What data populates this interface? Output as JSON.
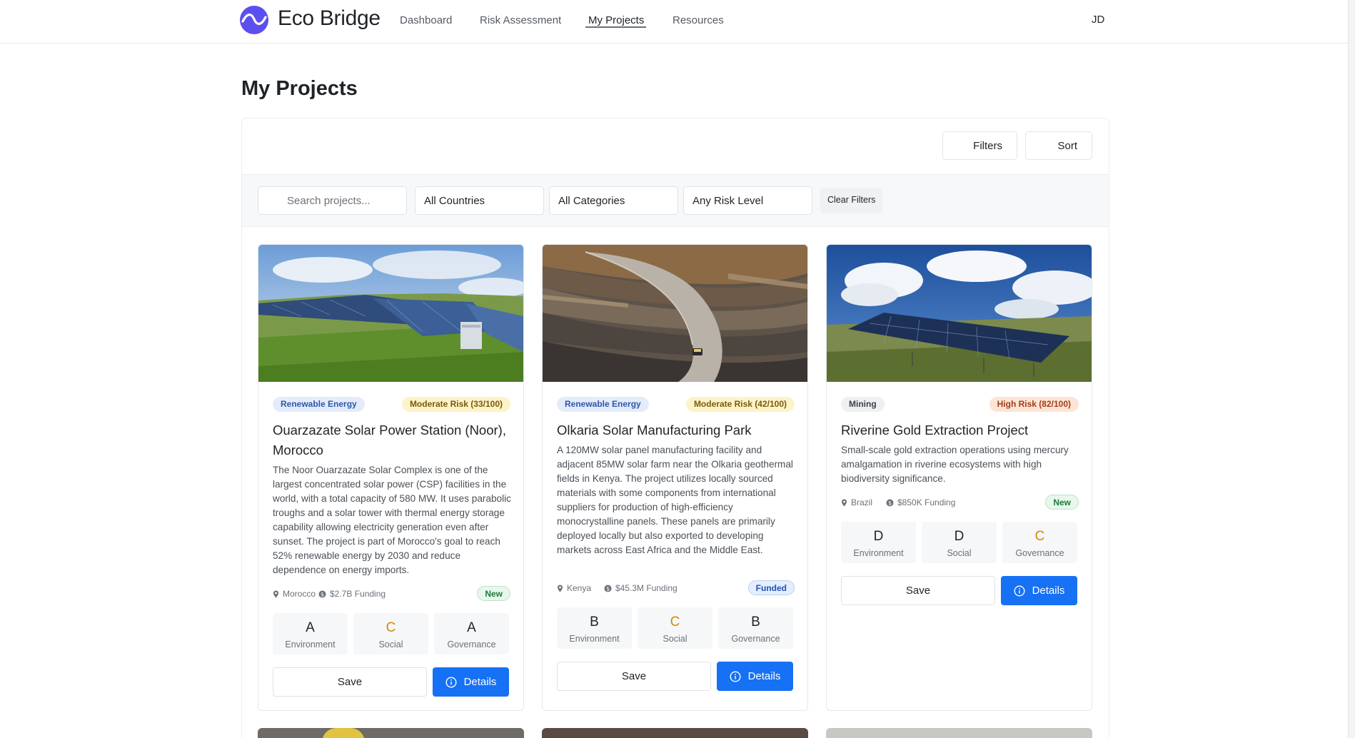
{
  "brand": {
    "name": "Eco Bridge"
  },
  "nav": {
    "items": [
      {
        "label": "Dashboard"
      },
      {
        "label": "Risk Assessment"
      },
      {
        "label": "My Projects"
      },
      {
        "label": "Resources"
      }
    ],
    "active": "My Projects",
    "avatar_initials": "JD"
  },
  "page": {
    "title": "My Projects"
  },
  "toolbar": {
    "filters_label": "Filters",
    "sort_label": "Sort"
  },
  "filters": {
    "search_placeholder": "Search projects...",
    "country": "All Countries",
    "category": "All Categories",
    "risk_level": "Any Risk Level",
    "clear_label": "Clear Filters"
  },
  "projects": [
    {
      "category": "Renewable Energy",
      "risk": "Moderate Risk (33/100)",
      "risk_level": "moderate",
      "title": "Ouarzazate Solar Power Station (Noor), Morocco",
      "description": "The Noor Ouarzazate Solar Complex is one of the largest concentrated solar power (CSP) facilities in the world, with a total capacity of 580 MW. It uses parabolic troughs and a solar tower with thermal energy storage capability allowing electricity generation even after sunset. The project is part of Morocco's goal to reach 52% renewable energy by 2030 and reduce dependence on energy imports.",
      "country": "Morocco",
      "funding": "$2.7B Funding",
      "status": "New",
      "grades": [
        {
          "letter": "A",
          "label": "Environment"
        },
        {
          "letter": "C",
          "label": "Social"
        },
        {
          "letter": "A",
          "label": "Governance"
        }
      ],
      "save_label": "Save",
      "details_label": "Details"
    },
    {
      "category": "Renewable Energy",
      "risk": "Moderate Risk (42/100)",
      "risk_level": "moderate",
      "title": "Olkaria Solar Manufacturing Park",
      "description": "A 120MW solar panel manufacturing facility and adjacent 85MW solar farm near the Olkaria geothermal fields in Kenya. The project utilizes locally sourced materials with some components from international suppliers for production of high-efficiency monocrystalline panels. These panels are primarily deployed locally but also exported to developing markets across East Africa and the Middle East.",
      "country": "Kenya",
      "funding": "$45.3M Funding",
      "status": "Funded",
      "grades": [
        {
          "letter": "B",
          "label": "Environment"
        },
        {
          "letter": "C",
          "label": "Social"
        },
        {
          "letter": "B",
          "label": "Governance"
        }
      ],
      "save_label": "Save",
      "details_label": "Details"
    },
    {
      "category": "Mining",
      "risk": "High Risk (82/100)",
      "risk_level": "high",
      "title": "Riverine Gold Extraction Project",
      "description": "Small-scale gold extraction operations using mercury amalgamation in riverine ecosystems with high biodiversity significance.",
      "country": "Brazil",
      "funding": "$850K Funding",
      "status": "New",
      "grades": [
        {
          "letter": "D",
          "label": "Environment"
        },
        {
          "letter": "D",
          "label": "Social"
        },
        {
          "letter": "C",
          "label": "Governance"
        }
      ],
      "save_label": "Save",
      "details_label": "Details"
    }
  ],
  "colors": {
    "brand": "#5b4ff0",
    "primary_button": "#1671f5",
    "grade_c": "#d88a00",
    "moderate_risk_bg": "#fdf3c8",
    "high_risk_bg": "#fde4d6",
    "new_badge": "#1d7a3a",
    "funded_badge": "#2152b8"
  },
  "icons": [
    "logo-wave-icon",
    "search-icon",
    "filter-icon",
    "sort-icon",
    "location-pin-icon",
    "dollar-icon",
    "info-circle-icon"
  ]
}
